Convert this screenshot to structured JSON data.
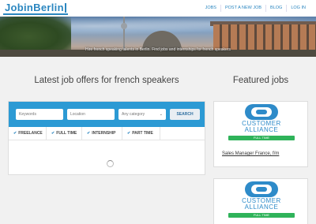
{
  "header": {
    "logo": "JobinBerlin",
    "nav": [
      "JOBS",
      "POST A NEW JOB",
      "BLOG",
      "LOG IN"
    ]
  },
  "hero": {
    "caption": "Hire french speaking talents in Berlin. Find jobs and internships for french speakers"
  },
  "main": {
    "title": "Latest job offers for french speakers",
    "search": {
      "keywords_placeholder": "Keywords",
      "location_placeholder": "Location",
      "category_value": "Any category",
      "search_label": "SEARCH"
    },
    "filters": [
      "FREELANCE",
      "FULL TIME",
      "INTERNSHIP",
      "PART TIME"
    ]
  },
  "featured": {
    "title": "Featured jobs",
    "jobs": [
      {
        "company_line1": "CUSTOMER",
        "company_line2": "ALLIANCE",
        "badge": "FULL TIME",
        "title": "Sales Manager France, f/m"
      },
      {
        "company_line1": "CUSTOMER",
        "company_line2": "ALLIANCE",
        "badge": "FULL TIME"
      }
    ]
  },
  "colors": {
    "brand": "#2a86c0",
    "search_bar": "#2c9ad4",
    "badge": "#2fb35a"
  }
}
